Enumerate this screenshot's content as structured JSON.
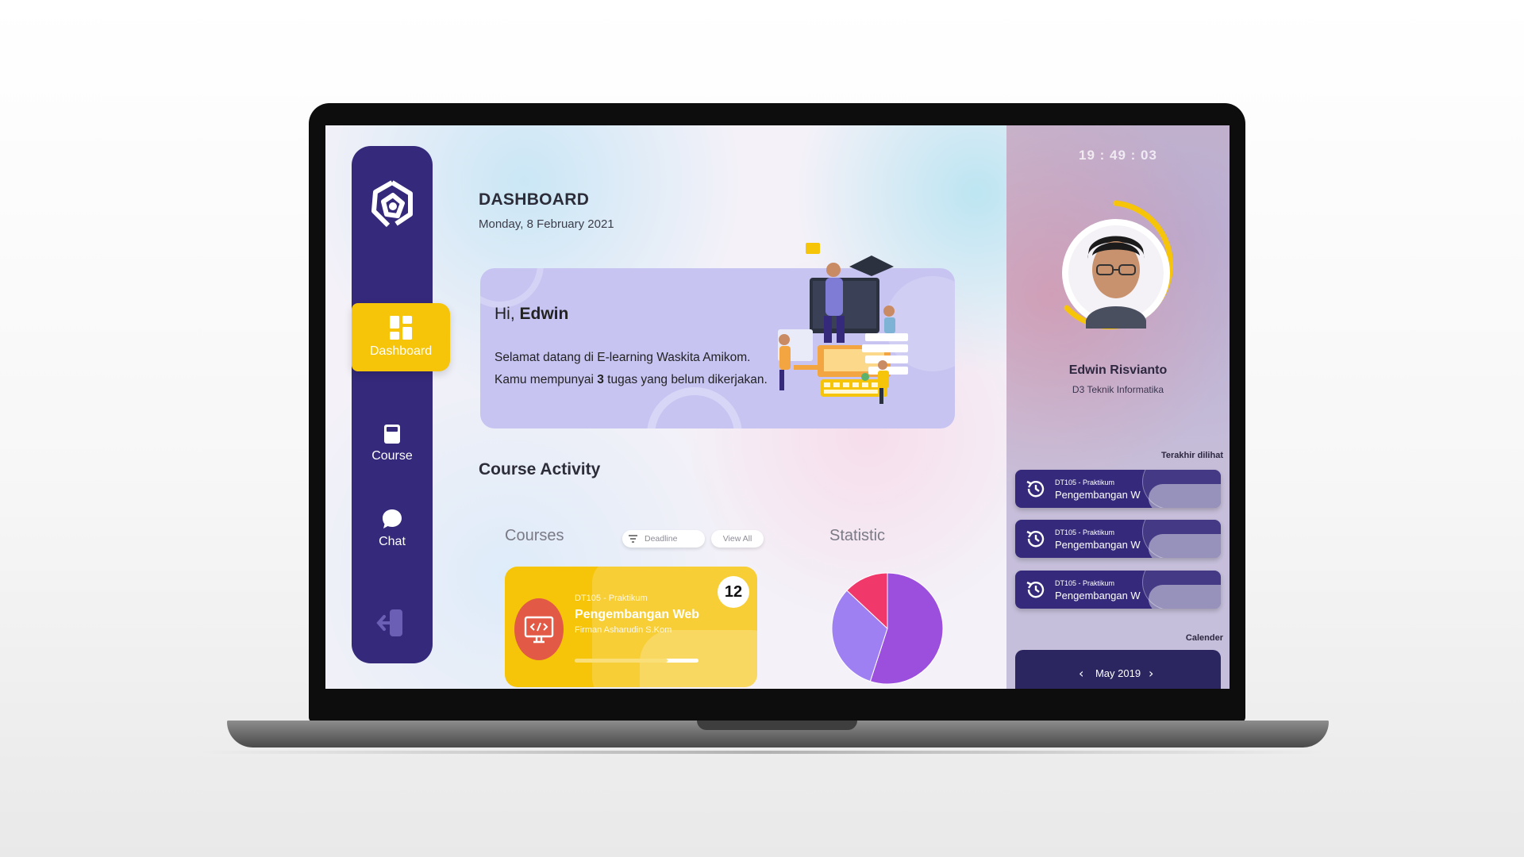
{
  "sidebar": {
    "items": [
      {
        "label": "Dashboard",
        "icon": "dashboard-grid-icon",
        "active": true
      },
      {
        "label": "Course",
        "icon": "book-icon"
      },
      {
        "label": "Chat",
        "icon": "chat-bubble-icon"
      }
    ],
    "logo_icon": "amikom-logo-icon",
    "logout_icon": "logout-icon"
  },
  "header": {
    "title": "DASHBOARD",
    "date": "Monday, 8 February 2021"
  },
  "welcome": {
    "greeting": "Hi,",
    "name": "Edwin",
    "line1": "Selamat datang di E-learning Waskita Amikom.",
    "line2_prefix": "Kamu mempunyai",
    "task_count": "3",
    "line2_suffix": "tugas yang belum dikerjakan."
  },
  "activity": {
    "title": "Course Activity",
    "courses_title": "Courses",
    "filter_label": "Deadline",
    "view_all_label": "View All",
    "course_card": {
      "code": "DT105 - Praktikum",
      "name": "Pengembangan Web",
      "lecturer": "Firman Asharudin S.Kom",
      "badge": "12",
      "progress": 0.75
    },
    "statistic_title": "Statistic"
  },
  "chart_data": {
    "type": "pie",
    "values": [
      55,
      32,
      13
    ],
    "colors": [
      "#9b4fdc",
      "#9f80f3",
      "#f0386b"
    ]
  },
  "profile": {
    "clock": "19 : 49 : 03",
    "name": "Edwin Risvianto",
    "major": "D3 Teknik Informatika"
  },
  "recent": {
    "label": "Terakhir dilihat",
    "items": [
      {
        "code": "DT105 - Praktikum",
        "name": "Pengembangan W"
      },
      {
        "code": "DT105 - Praktikum",
        "name": "Pengembangan W"
      },
      {
        "code": "DT105 - Praktikum",
        "name": "Pengembangan W"
      }
    ]
  },
  "calendar": {
    "label": "Calender",
    "month": "May 2019"
  },
  "colors": {
    "sidebar": "#34297a",
    "accent": "#f6c409",
    "welcome_card": "#c7c4f2"
  }
}
